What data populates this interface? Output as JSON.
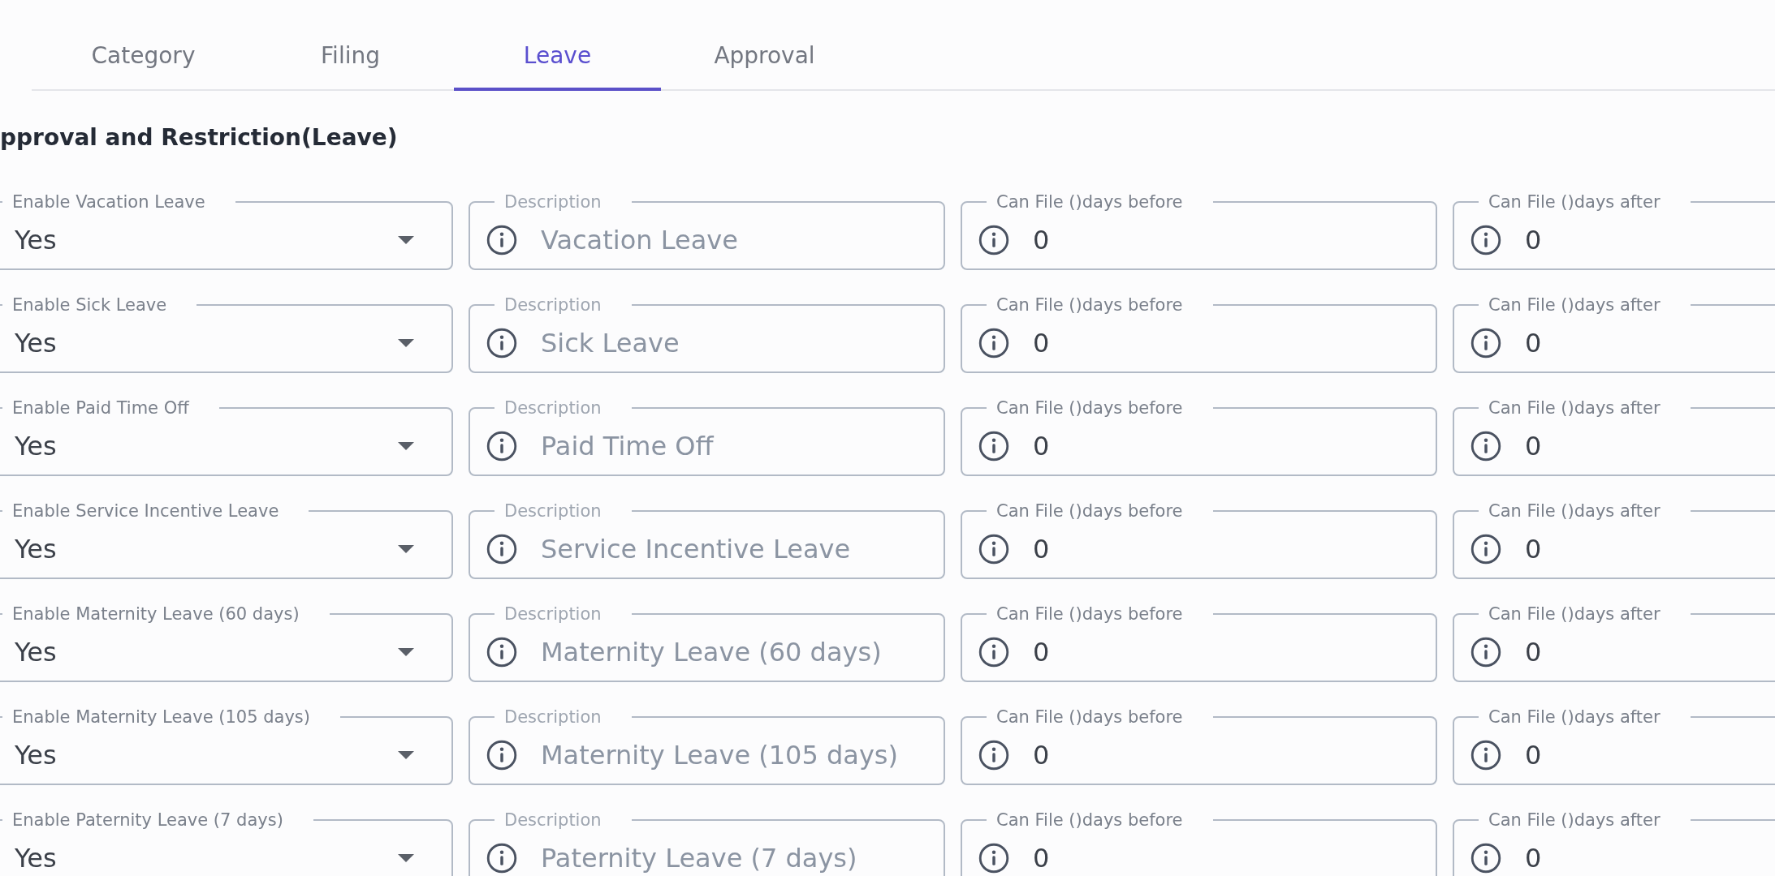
{
  "tabs": [
    {
      "label": "Category",
      "selected": false
    },
    {
      "label": "Filing",
      "selected": false
    },
    {
      "label": "Leave",
      "selected": true
    },
    {
      "label": "Approval",
      "selected": false
    }
  ],
  "heading": "pproval and Restriction(Leave)",
  "rows": [
    {
      "fields": [
        {
          "kind": "select",
          "label": "Enable Vacation Leave",
          "value": "Yes",
          "disabled": false
        },
        {
          "kind": "info_input",
          "label": "Description",
          "value": "Vacation Leave",
          "disabled": true
        },
        {
          "kind": "info_input",
          "label": "Can File ()days before",
          "value": "0",
          "disabled": false
        },
        {
          "kind": "info_input",
          "label": "Can File ()days after",
          "value": "0",
          "disabled": false
        }
      ]
    },
    {
      "fields": [
        {
          "kind": "select",
          "label": "Enable Sick Leave",
          "value": "Yes",
          "disabled": false
        },
        {
          "kind": "info_input",
          "label": "Description",
          "value": "Sick Leave",
          "disabled": true
        },
        {
          "kind": "info_input",
          "label": "Can File ()days before",
          "value": "0",
          "disabled": false
        },
        {
          "kind": "info_input",
          "label": "Can File ()days after",
          "value": "0",
          "disabled": false
        }
      ]
    },
    {
      "fields": [
        {
          "kind": "select",
          "label": "Enable Paid Time Off",
          "value": "Yes",
          "disabled": false
        },
        {
          "kind": "info_input",
          "label": "Description",
          "value": "Paid Time Off",
          "disabled": true
        },
        {
          "kind": "info_input",
          "label": "Can File ()days before",
          "value": "0",
          "disabled": false
        },
        {
          "kind": "info_input",
          "label": "Can File ()days after",
          "value": "0",
          "disabled": false
        }
      ]
    },
    {
      "fields": [
        {
          "kind": "select",
          "label": "Enable Service Incentive Leave",
          "value": "Yes",
          "disabled": false
        },
        {
          "kind": "info_input",
          "label": "Description",
          "value": "Service Incentive Leave",
          "disabled": true
        },
        {
          "kind": "info_input",
          "label": "Can File ()days before",
          "value": "0",
          "disabled": false
        },
        {
          "kind": "info_input",
          "label": "Can File ()days after",
          "value": "0",
          "disabled": false
        }
      ]
    },
    {
      "fields": [
        {
          "kind": "select",
          "label": "Enable Maternity Leave (60 days)",
          "value": "Yes",
          "disabled": false
        },
        {
          "kind": "info_input",
          "label": "Description",
          "value": "Maternity Leave (60 days)",
          "disabled": true
        },
        {
          "kind": "info_input",
          "label": "Can File ()days before",
          "value": "0",
          "disabled": false
        },
        {
          "kind": "info_input",
          "label": "Can File ()days after",
          "value": "0",
          "disabled": false
        }
      ]
    },
    {
      "fields": [
        {
          "kind": "select",
          "label": "Enable Maternity Leave (105 days)",
          "value": "Yes",
          "disabled": false
        },
        {
          "kind": "info_input",
          "label": "Description",
          "value": "Maternity Leave (105 days)",
          "disabled": true
        },
        {
          "kind": "info_input",
          "label": "Can File ()days before",
          "value": "0",
          "disabled": false
        },
        {
          "kind": "info_input",
          "label": "Can File ()days after",
          "value": "0",
          "disabled": false
        }
      ]
    },
    {
      "fields": [
        {
          "kind": "select",
          "label": "Enable Paternity Leave (7 days)",
          "value": "Yes",
          "disabled": false
        },
        {
          "kind": "info_input",
          "label": "Description",
          "value": "Paternity Leave (7 days)",
          "disabled": true
        },
        {
          "kind": "info_input",
          "label": "Can File ()days before",
          "value": "0",
          "disabled": false
        },
        {
          "kind": "info_input",
          "label": "Can File ()days after",
          "value": "0",
          "disabled": false
        }
      ]
    }
  ]
}
